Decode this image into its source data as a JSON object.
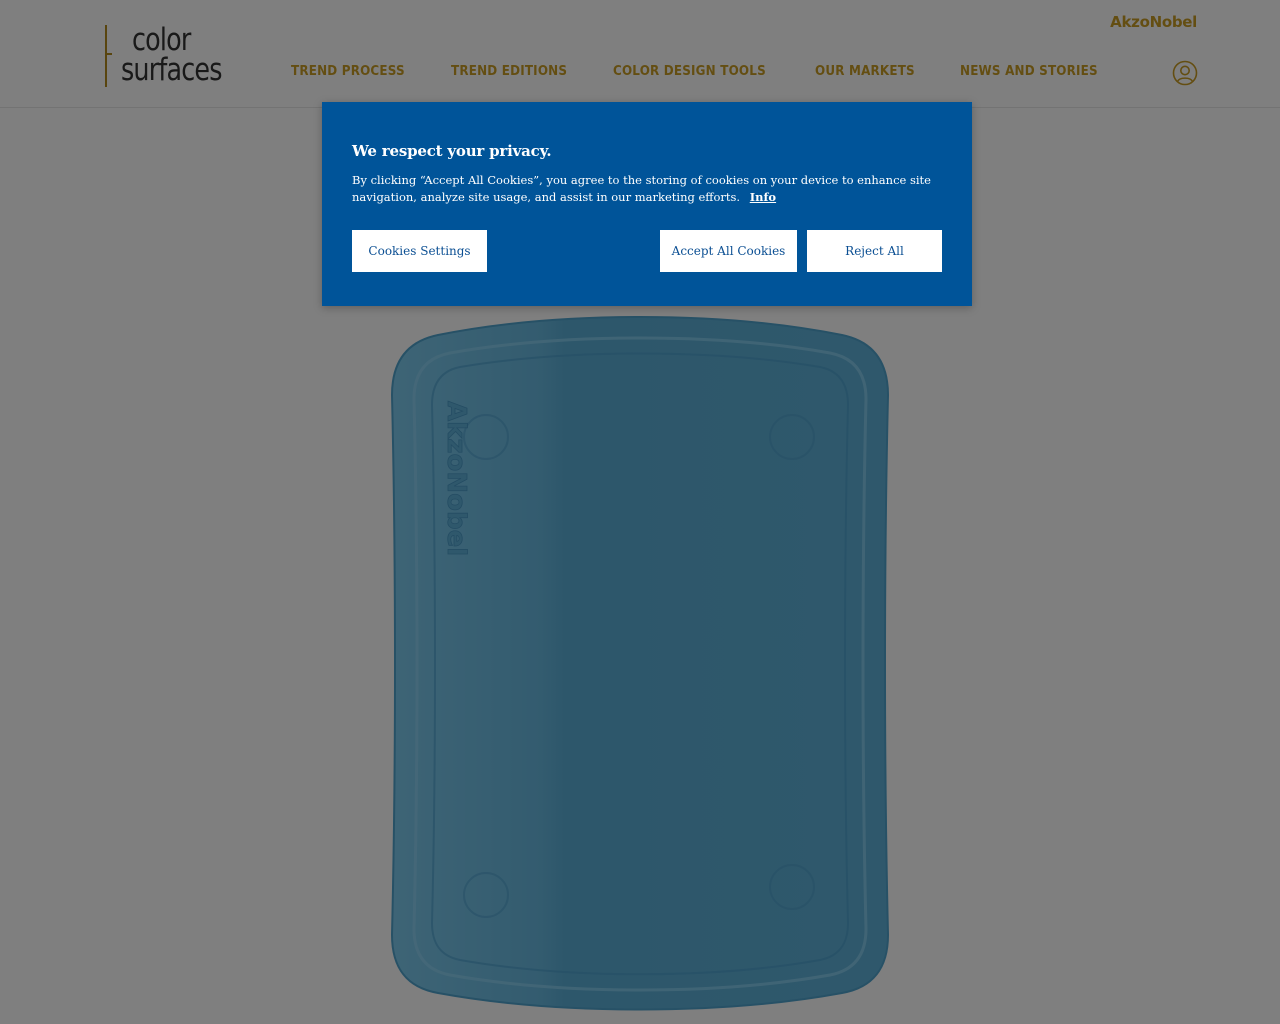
{
  "logo": {
    "line1": "color",
    "line2": "surfaces"
  },
  "brand": "AkzoNobel",
  "nav": {
    "items": [
      {
        "label": "TREND PROCESS"
      },
      {
        "label": "TREND EDITIONS"
      },
      {
        "label": "COLOR DESIGN TOOLS"
      },
      {
        "label": "OUR MARKETS"
      },
      {
        "label": "NEWS AND STORIES"
      }
    ]
  },
  "hero": {
    "embossed_text": "AkzoNobel",
    "color": "#5fb8e3"
  },
  "cookie": {
    "title": "We respect your privacy.",
    "text": "By clicking “Accept All Cookies”, you agree to the storing of cookies on your device to enhance site navigation, analyze site usage, and assist in our marketing efforts.",
    "info_link": "Info",
    "settings_button": "Cookies Settings",
    "accept_button": "Accept All Cookies",
    "reject_button": "Reject All",
    "background": "#005499"
  },
  "colors": {
    "accent_gold": "#c99d25",
    "overlay": "rgba(0,0,0,0.5)"
  },
  "icons": {
    "user": "user-account-icon"
  }
}
